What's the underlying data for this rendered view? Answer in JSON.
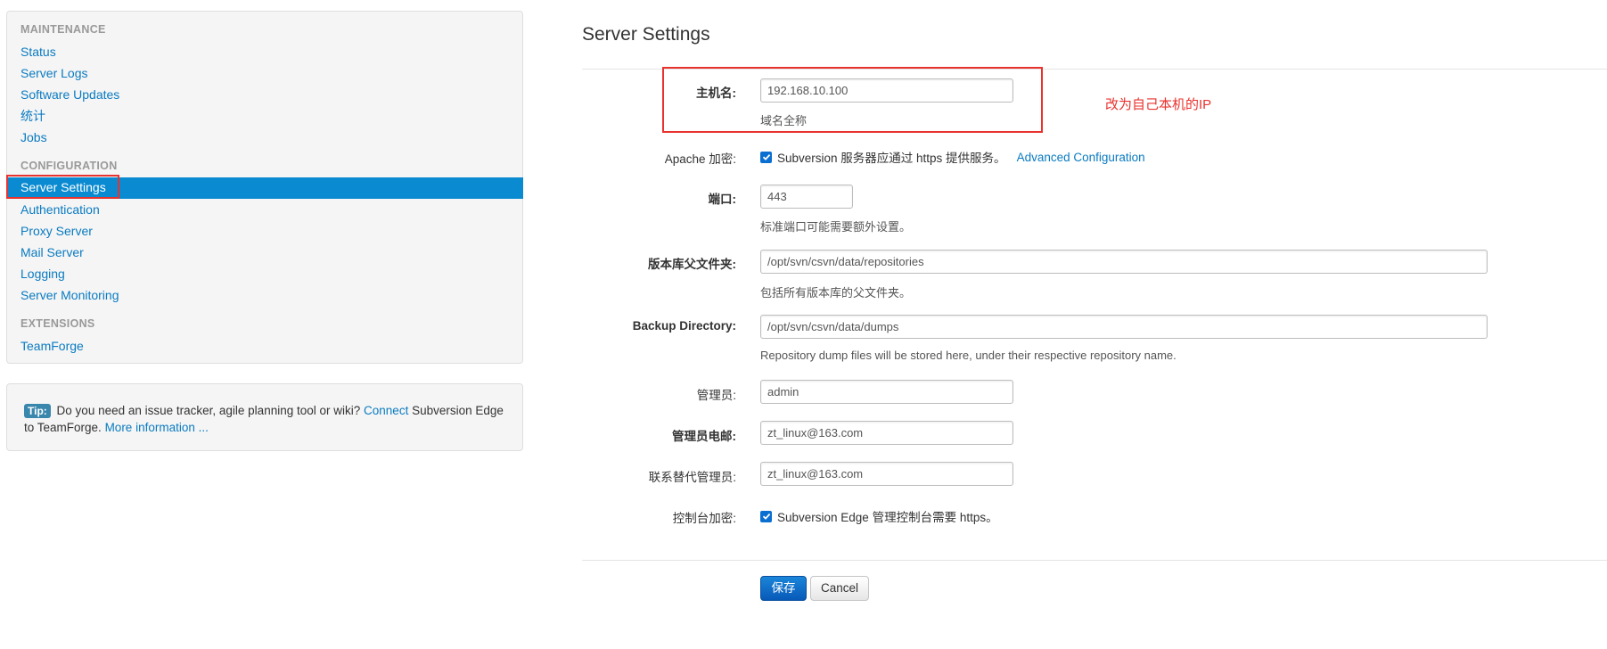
{
  "sidebar": {
    "sections": [
      {
        "header": "MAINTENANCE",
        "items": [
          "Status",
          "Server Logs",
          "Software Updates",
          "统计",
          "Jobs"
        ]
      },
      {
        "header": "CONFIGURATION",
        "items": [
          "Server Settings",
          "Authentication",
          "Proxy Server",
          "Mail Server",
          "Logging",
          "Server Monitoring"
        ]
      },
      {
        "header": "EXTENSIONS",
        "items": [
          "TeamForge"
        ]
      }
    ],
    "active_item": "Server Settings"
  },
  "tip": {
    "badge": "Tip:",
    "text_before": "Do you need an issue tracker, agile planning tool or wiki?",
    "connect_link": "Connect",
    "text_after": "Subversion Edge to TeamForge.",
    "more_link": "More information ..."
  },
  "main": {
    "title": "Server Settings",
    "hostname": {
      "label": "主机名:",
      "value": "192.168.10.100",
      "help": "域名全称"
    },
    "apache": {
      "label": "Apache 加密:",
      "checkbox_label": "Subversion 服务器应通过 https 提供服务。",
      "checked": true,
      "link": "Advanced Configuration"
    },
    "port": {
      "label": "端口:",
      "value": "443",
      "help": "标准端口可能需要额外设置。"
    },
    "repo_parent": {
      "label": "版本库父文件夹:",
      "value": "/opt/svn/csvn/data/repositories",
      "help": "包括所有版本库的父文件夹。"
    },
    "backup_dir": {
      "label": "Backup Directory:",
      "value": "/opt/svn/csvn/data/dumps",
      "help": "Repository dump files will be stored here, under their respective repository name."
    },
    "admin": {
      "label": "管理员:",
      "value": "admin"
    },
    "admin_email": {
      "label": "管理员电邮:",
      "value": "zt_linux@163.com"
    },
    "alt_admin": {
      "label": "联系替代管理员:",
      "value": "zt_linux@163.com"
    },
    "console_encrypt": {
      "label": "控制台加密:",
      "checkbox_label": "Subversion Edge 管理控制台需要 https。",
      "checked": true
    },
    "save_label": "保存",
    "cancel_label": "Cancel"
  },
  "annotation": "改为自己本机的IP",
  "colors": {
    "accent": "#0a8bd1",
    "highlight": "#e8322e",
    "link": "#0a7bc1"
  }
}
